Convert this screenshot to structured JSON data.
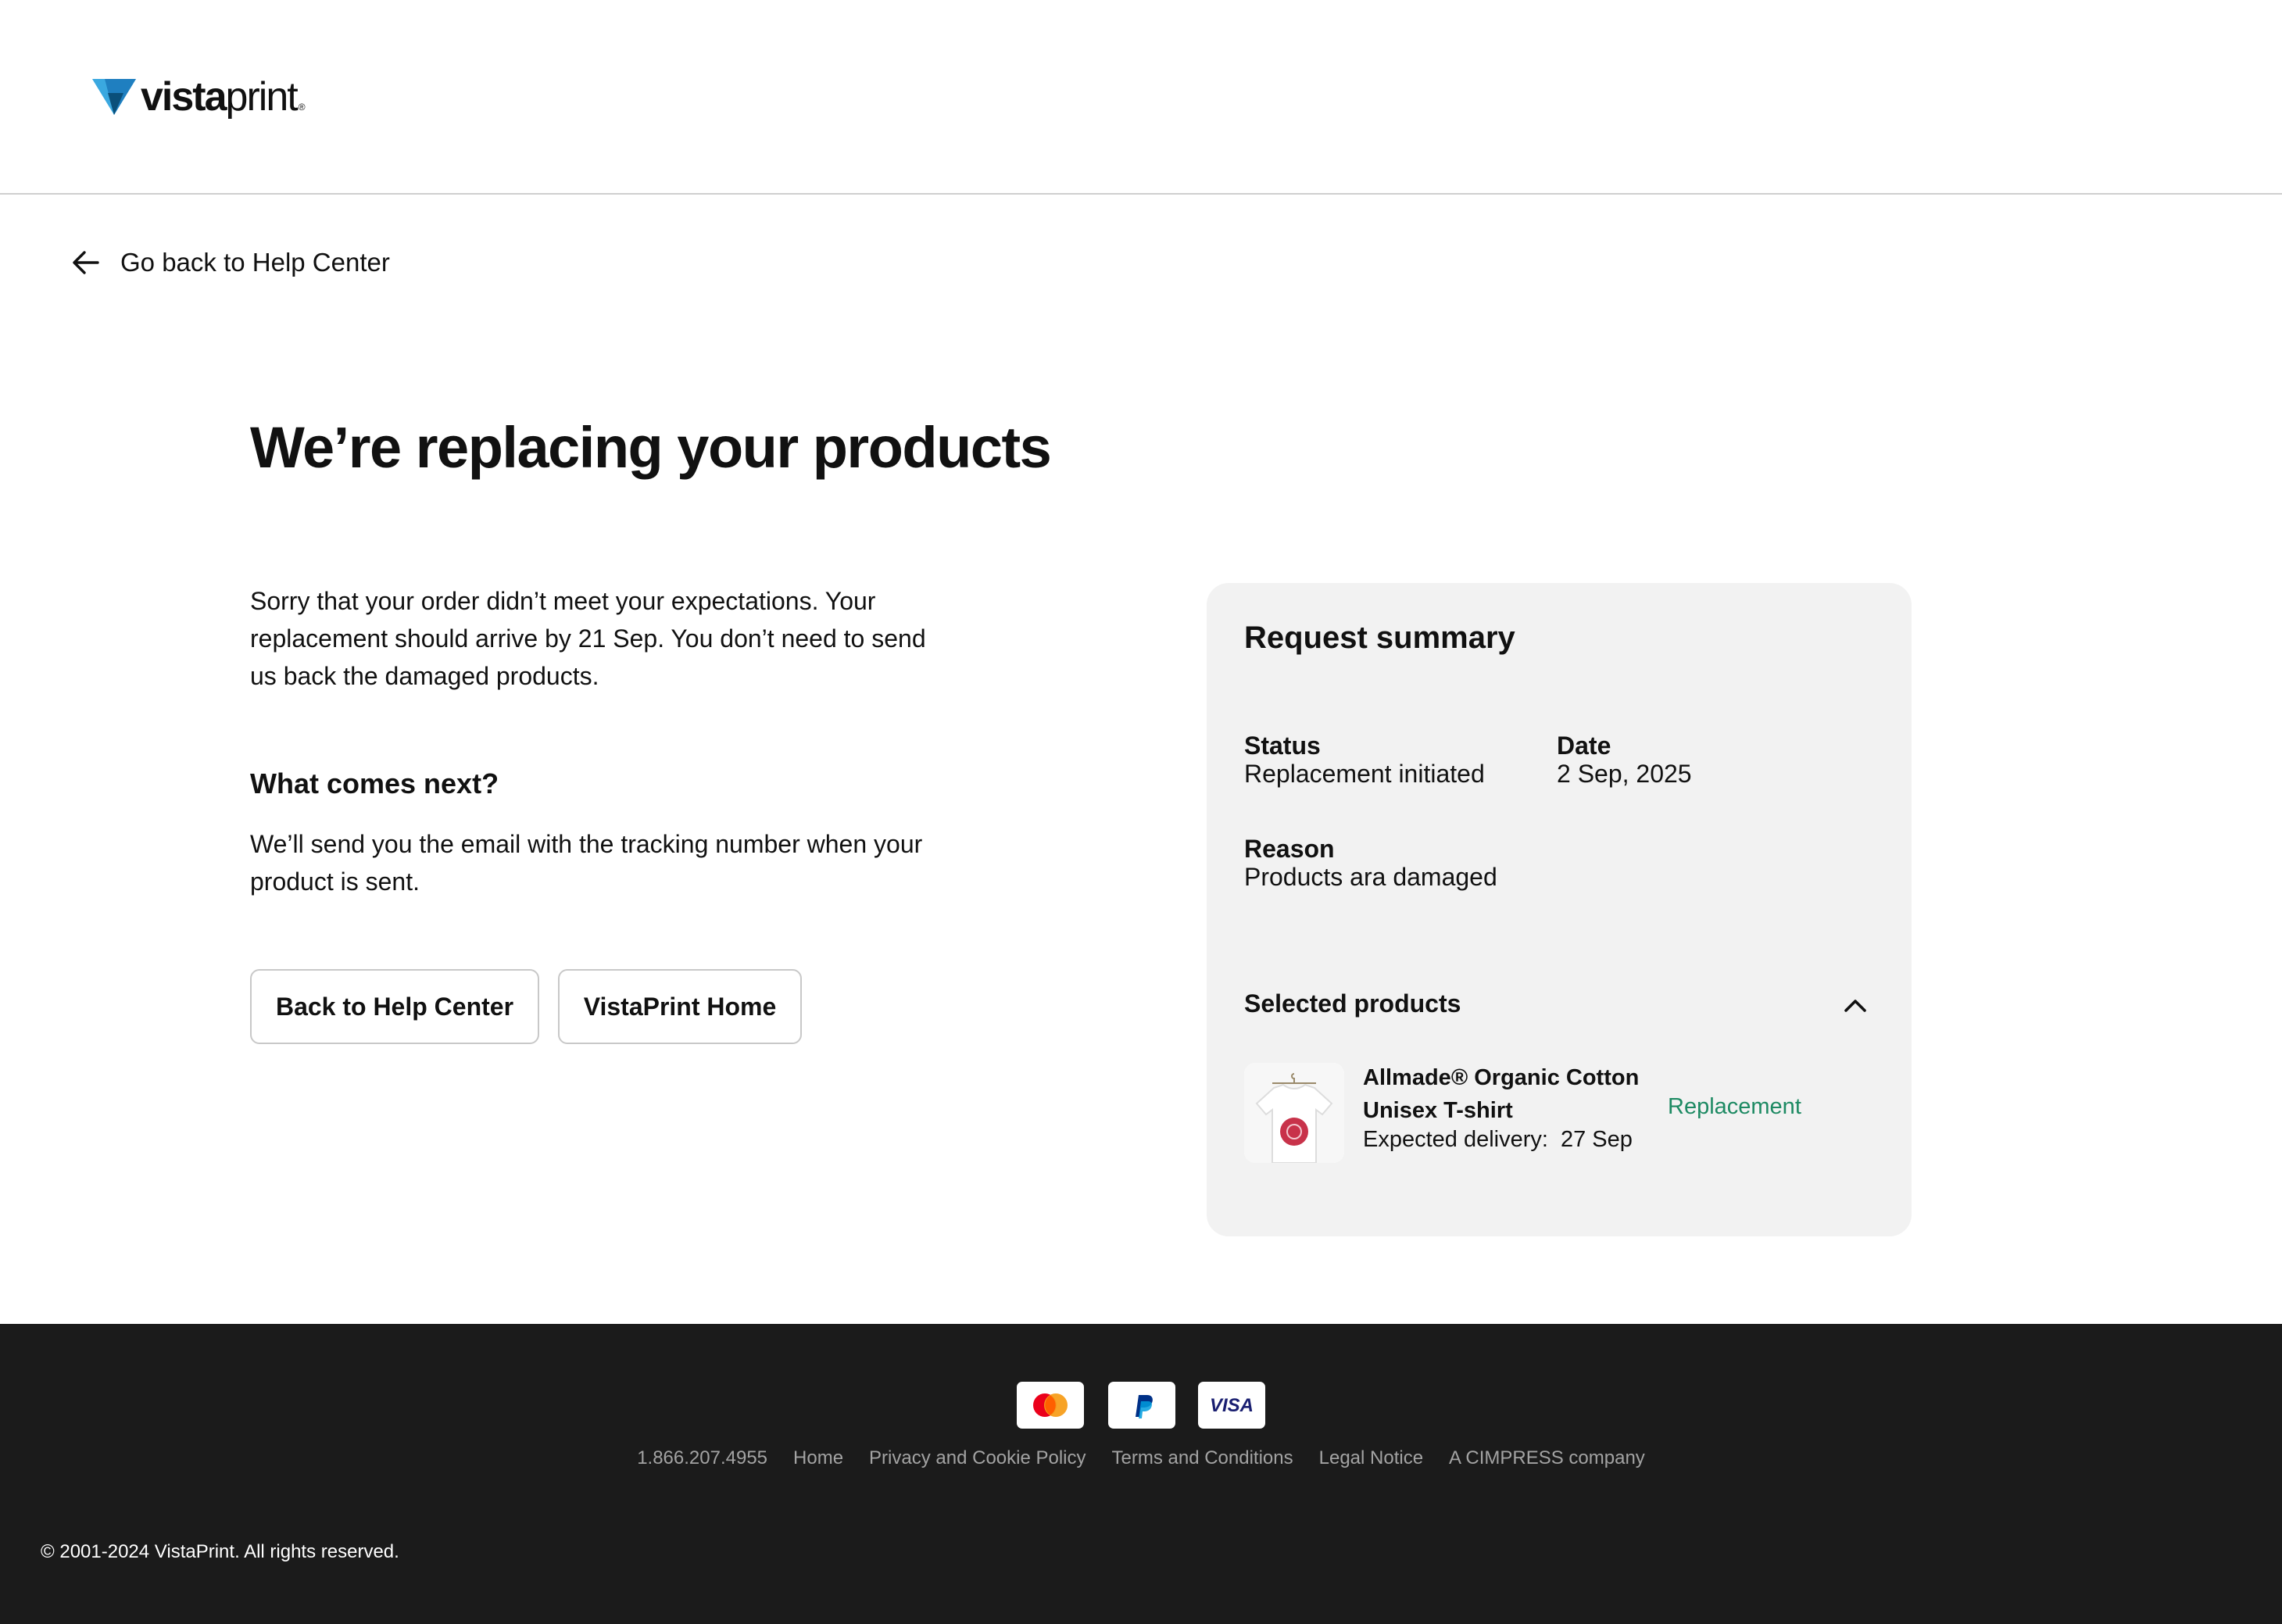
{
  "brand": {
    "logo_bold": "vista",
    "logo_light": "print",
    "logo_mark": "®",
    "logo_colors": {
      "triangle_light": "#3aa8e0",
      "triangle_dark": "#0a5b8a"
    }
  },
  "nav": {
    "back_link_label": "Go back to Help Center",
    "back_icon": "arrow-left-icon"
  },
  "main": {
    "title": "We’re replacing your products",
    "intro": "Sorry that your order didn’t meet your expectations. Your replacement should arrive by 21 Sep. You don’t need to send us back the damaged products.",
    "next_heading": "What comes next?",
    "next_text": "We’ll send you the email with the tracking number when your product is sent.",
    "buttons": {
      "help_center": "Back to Help Center",
      "home": "VistaPrint Home"
    }
  },
  "summary": {
    "title": "Request summary",
    "status_label": "Status",
    "status_value": "Replacement initiated",
    "date_label": "Date",
    "date_value": "2 Sep, 2025",
    "reason_label": "Reason",
    "reason_value": "Products ara damaged",
    "selected_heading": "Selected products",
    "collapse_icon": "chevron-up-icon",
    "products": [
      {
        "name": "Allmade® Organic Cotton Unisex T-shirt",
        "delivery_label": "Expected delivery:",
        "delivery_date": "27 Sep",
        "status": "Replacement",
        "status_color": "#1d8a63",
        "thumbnail": "tshirt-thumbnail"
      }
    ]
  },
  "footer": {
    "payment_icons": [
      "mastercard-icon",
      "paypal-icon",
      "visa-icon"
    ],
    "visa_text": "VISA",
    "links": {
      "phone": "1.866.207.4955",
      "home": "Home",
      "privacy": "Privacy and Cookie Policy",
      "terms": "Terms and Conditions",
      "legal": "Legal Notice",
      "company": "A CIMPRESS company"
    },
    "copyright": "© 2001-2024 VistaPrint. All rights reserved."
  },
  "colors": {
    "footer_bg": "#1b1b1b",
    "card_bg": "#f2f2f2",
    "accent_green": "#1d8a63"
  }
}
